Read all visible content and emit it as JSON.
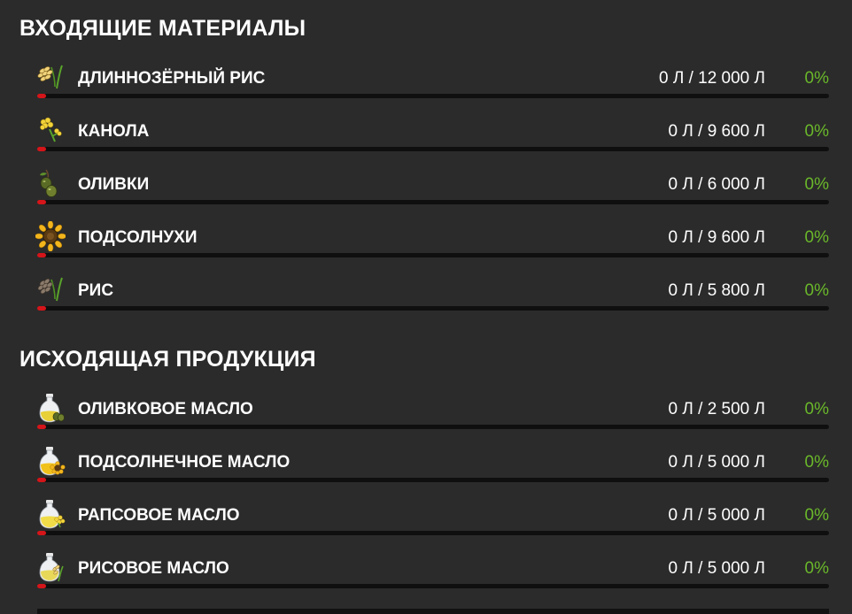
{
  "input_section": {
    "title": "ВХОДЯЩИЕ МАТЕРИАЛЫ",
    "items": [
      {
        "icon": "long-grain-rice-icon",
        "name": "ДЛИННОЗЁРНЫЙ РИС",
        "amount": "0 Л / 12 000 Л",
        "percent": "0%",
        "fill": 0
      },
      {
        "icon": "canola-icon",
        "name": "КАНОЛА",
        "amount": "0 Л / 9 600 Л",
        "percent": "0%",
        "fill": 0
      },
      {
        "icon": "olives-icon",
        "name": "ОЛИВКИ",
        "amount": "0 Л / 6 000 Л",
        "percent": "0%",
        "fill": 0
      },
      {
        "icon": "sunflower-icon",
        "name": "ПОДСОЛНУХИ",
        "amount": "0 Л / 9 600 Л",
        "percent": "0%",
        "fill": 0
      },
      {
        "icon": "rice-icon",
        "name": "РИС",
        "amount": "0 Л / 5 800 Л",
        "percent": "0%",
        "fill": 0
      }
    ]
  },
  "output_section": {
    "title": "ИСХОДЯЩАЯ ПРОДУКЦИЯ",
    "items": [
      {
        "icon": "olive-oil-icon",
        "name": "ОЛИВКОВОЕ МАСЛО",
        "amount": "0 Л / 2 500 Л",
        "percent": "0%",
        "fill": 0
      },
      {
        "icon": "sunflower-oil-icon",
        "name": "ПОДСОЛНЕЧНОЕ МАСЛО",
        "amount": "0 Л / 5 000 Л",
        "percent": "0%",
        "fill": 0
      },
      {
        "icon": "canola-oil-icon",
        "name": "РАПСОВОЕ МАСЛО",
        "amount": "0 Л / 5 000 Л",
        "percent": "0%",
        "fill": 0
      },
      {
        "icon": "rice-oil-icon",
        "name": "РИСОВОЕ МАСЛО",
        "amount": "0 Л / 5 000 Л",
        "percent": "0%",
        "fill": 0
      }
    ]
  },
  "colors": {
    "background": "#2b2b2b",
    "percent_text": "#6ab82a",
    "bar_track": "#0f0f0f",
    "bar_fill": "#d4151a"
  }
}
